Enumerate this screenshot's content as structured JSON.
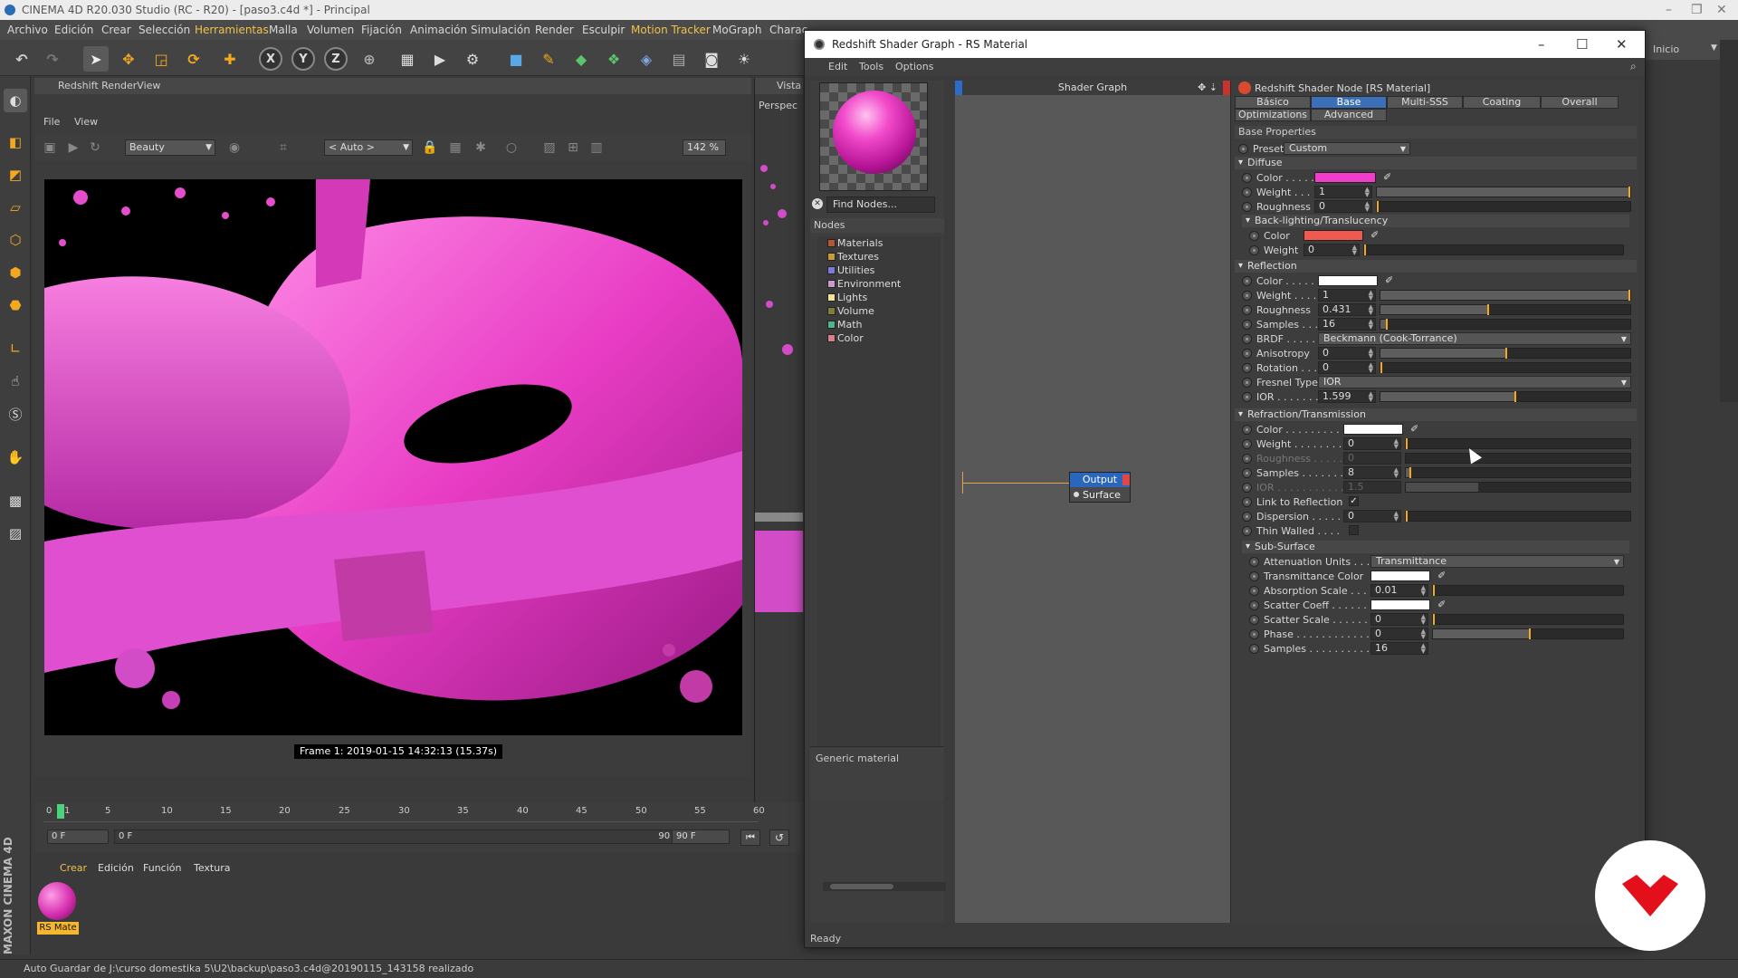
{
  "app": {
    "title": "CINEMA 4D R20.030 Studio (RC - R20) - [paso3.c4d *] - Principal",
    "menu": [
      "Archivo",
      "Edición",
      "Crear",
      "Selección",
      "Herramientas",
      "Malla",
      "Volumen",
      "Fijación",
      "Animación",
      "Simulación",
      "Render",
      "Esculpir",
      "Motion Tracker",
      "MoGraph",
      "Charac"
    ],
    "brand": "MAXON CINEMA 4D",
    "layout_label": "Inicio"
  },
  "renderview": {
    "title": "Redshift RenderView",
    "menu": [
      "File",
      "View"
    ],
    "aov": "Beauty",
    "camera": "< Auto >",
    "zoom": "142 %",
    "frame_info": "Frame  1:  2019-01-15  14:32:13  (15.37s)"
  },
  "viewport": {
    "tab": "Vista",
    "mode": "Perspec"
  },
  "timeline": {
    "ticks": [
      "0",
      "1",
      "5",
      "10",
      "15",
      "20",
      "25",
      "30",
      "35",
      "40",
      "45",
      "50",
      "55",
      "60"
    ],
    "start": "0 F",
    "current": "0 F",
    "end_in": "90 F",
    "end": "90 F"
  },
  "material_manager": {
    "menu": [
      "Crear",
      "Edición",
      "Función",
      "Textura"
    ],
    "material_label": "RS Mate"
  },
  "status": "Auto Guardar de J:\\curso domestika 5\\U2\\backup\\paso3.c4d@20190115_143158 realizado",
  "shader_graph": {
    "title": "Redshift Shader Graph - RS Material",
    "menu": [
      "Edit",
      "Tools",
      "Options"
    ],
    "find_placeholder": "Find Nodes...",
    "nodes_header": "Nodes",
    "node_categories": [
      {
        "label": "Materials",
        "color": "#b5553a"
      },
      {
        "label": "Textures",
        "color": "#c79a3c"
      },
      {
        "label": "Utilities",
        "color": "#7d7bd8"
      },
      {
        "label": "Environment",
        "color": "#c79ac9"
      },
      {
        "label": "Lights",
        "color": "#f0e39a"
      },
      {
        "label": "Volume",
        "color": "#7f7f3a"
      },
      {
        "label": "Math",
        "color": "#4fb58a"
      },
      {
        "label": "Color",
        "color": "#d8808a"
      }
    ],
    "description": "Generic material",
    "graph_header": "Shader Graph",
    "output_node": {
      "title": "Output",
      "port": "Surface"
    },
    "status": "Ready"
  },
  "properties": {
    "title": "Redshift Shader Node [RS Material]",
    "tabs_row1": [
      "Básico",
      "Base Properties",
      "Multi-SSS",
      "Coating",
      "Overall"
    ],
    "tabs_row2": [
      "Optimizations",
      "Advanced"
    ],
    "active_tab": "Base Properties",
    "section_title": "Base Properties",
    "preset_label": "Preset",
    "preset_value": "Custom",
    "diffuse": {
      "title": "Diffuse",
      "color_label": "Color . . . . .",
      "color": "#f23ccc",
      "weight_label": "Weight . . . .",
      "weight": "1",
      "roughness_label": "Roughness",
      "roughness": "0"
    },
    "backlighting": {
      "title": "Back-lighting/Translucency",
      "color_label": "Color",
      "color": "#f05a4e",
      "weight_label": "Weight",
      "weight": "0"
    },
    "reflection": {
      "title": "Reflection",
      "color_label": "Color . . . . .",
      "color": "#ffffff",
      "weight_label": "Weight . . . .",
      "weight": "1",
      "roughness_label": "Roughness",
      "roughness": "0.431",
      "samples_label": "Samples . . .",
      "samples": "16",
      "brdf_label": "BRDF . . . . . .",
      "brdf": "Beckmann (Cook-Torrance)",
      "anisotropy_label": "Anisotropy",
      "anisotropy": "0",
      "rotation_label": "Rotation . . .",
      "rotation": "0",
      "fresnel_label": "Fresnel Type",
      "fresnel": "IOR",
      "ior_label": "IOR . . . . . . . .",
      "ior": "1.599"
    },
    "refraction": {
      "title": "Refraction/Transmission",
      "color_label": "Color . . . . . . . . .",
      "color": "#ffffff",
      "weight_label": "Weight . . . . . . . .",
      "weight": "0",
      "roughness_label": "Roughness . . . . .",
      "roughness": "0",
      "samples_label": "Samples . . . . . . .",
      "samples": "8",
      "ior_label": "IOR . . . . . . . . . . . .",
      "ior": "1.5",
      "link_label": "Link to Reflection",
      "link_checked": "✓",
      "dispersion_label": "Dispersion . . . . .",
      "dispersion": "0",
      "thin_label": "Thin Walled . . . .",
      "thin_checked": ""
    },
    "subsurface": {
      "title": "Sub-Surface",
      "atten_label": "Attenuation Units . . .",
      "atten": "Transmittance",
      "trans_color_label": "Transmittance Color",
      "abs_label": "Absorption Scale . . . .",
      "abs": "0.01",
      "scatter_coeff_label": "Scatter Coeff . . . . . . .",
      "scatter_scale_label": "Scatter Scale . . . . . . .",
      "scatter_scale": "0",
      "phase_label": "Phase . . . . . . . . . . . . .",
      "phase": "0",
      "samples_label": "Samples . . . . . . . . . . .",
      "samples": "16"
    }
  }
}
